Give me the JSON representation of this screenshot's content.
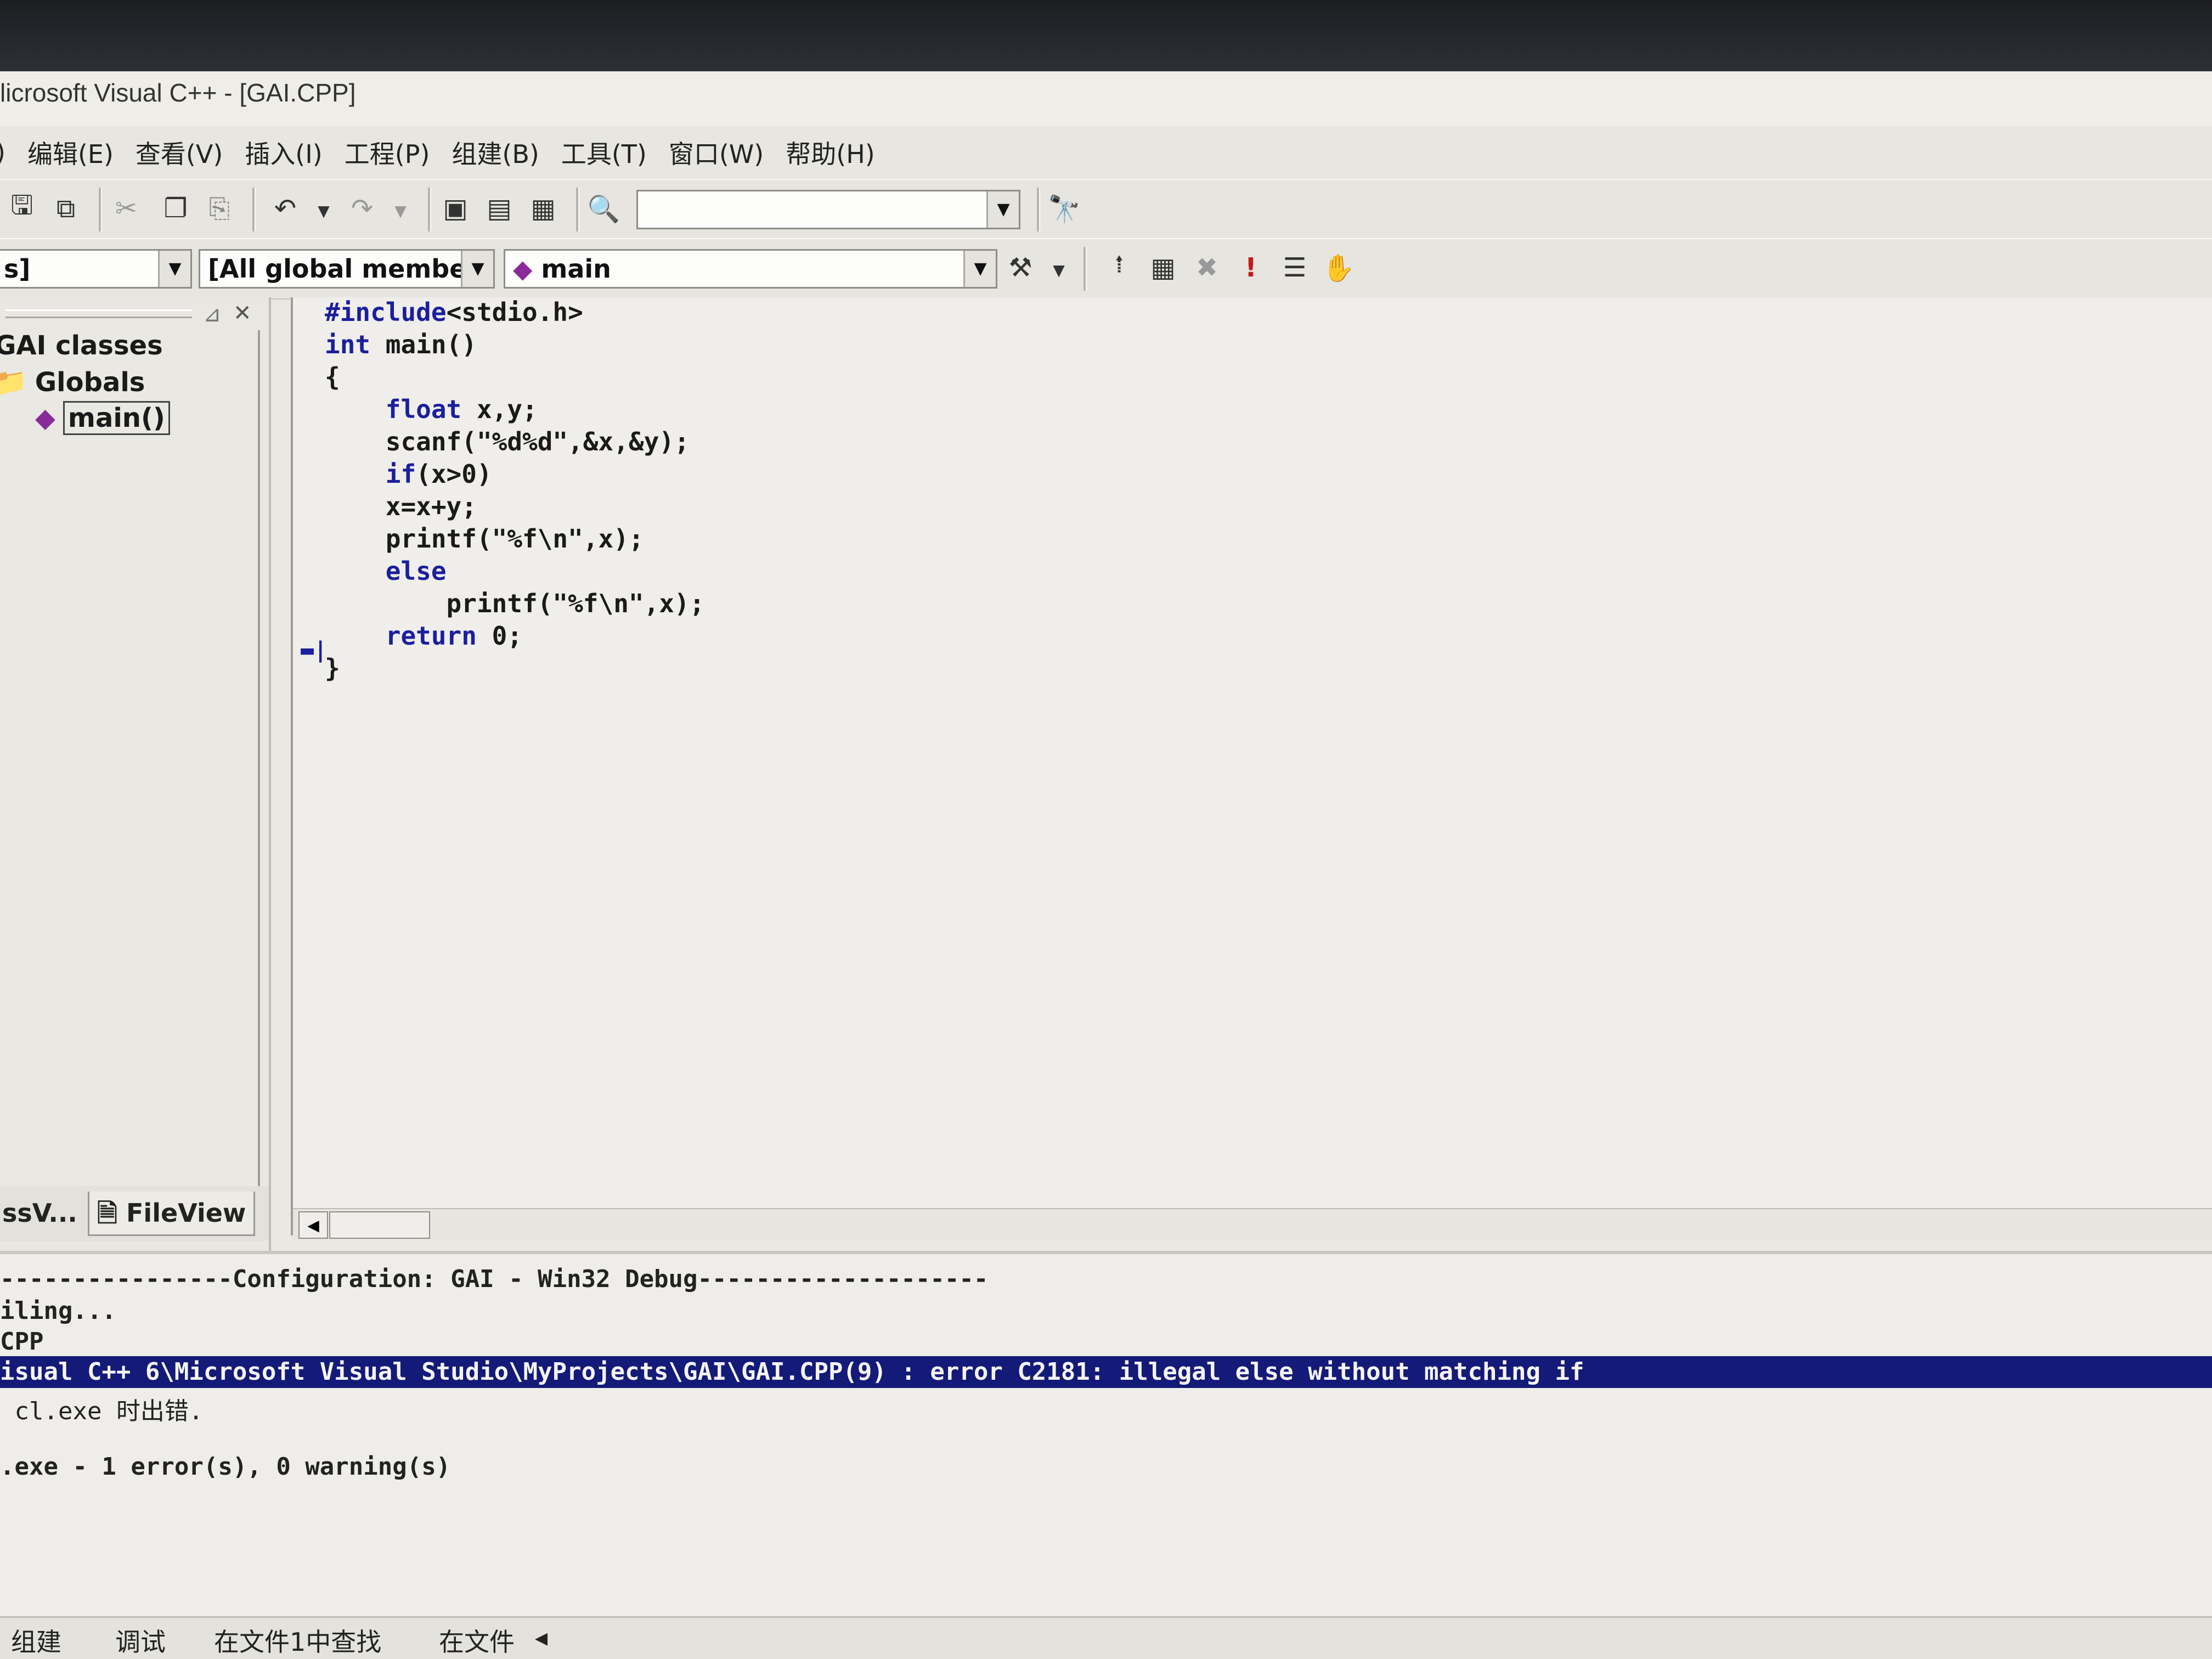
{
  "window": {
    "title": "licrosoft Visual C++ - [GAI.CPP]"
  },
  "menu": [
    {
      "label": ")"
    },
    {
      "label": "编辑(E)"
    },
    {
      "label": "查看(V)"
    },
    {
      "label": "插入(I)"
    },
    {
      "label": "工程(P)"
    },
    {
      "label": "组建(B)"
    },
    {
      "label": "工具(T)"
    },
    {
      "label": "窗口(W)"
    },
    {
      "label": "帮助(H)"
    }
  ],
  "toolbar": {
    "find_combo_value": "",
    "class_combo_value": "s]",
    "filter_combo_value": "[All global members",
    "function_combo_value": "main"
  },
  "workspace": {
    "tree": {
      "root": "GAI classes",
      "group": "Globals",
      "item": "main()"
    },
    "tabs": {
      "class_view": "ssV...",
      "file_view": "FileView"
    }
  },
  "editor": {
    "lines": [
      "#include<stdio.h>",
      "int main()",
      "{",
      "    float x,y;",
      "    scanf(\"%d%d\",&x,&y);",
      "    if(x>0)",
      "    x=x+y;",
      "    printf(\"%f\\n\",x);",
      "    else",
      "        printf(\"%f\\n\",x);",
      "    return 0;",
      "}"
    ]
  },
  "output": {
    "lines": [
      "----------------Configuration: GAI - Win32 Debug--------------------",
      "iling...",
      "CPP",
      "isual C++ 6\\Microsoft Visual Studio\\MyProjects\\GAI\\GAI.CPP(9) : error C2181: illegal else without matching if",
      " cl.exe 时出错.",
      "",
      ".exe - 1 error(s), 0 warning(s)"
    ],
    "tabs": [
      "组建",
      "调试",
      "在文件1中查找",
      "在文件"
    ]
  },
  "colors": {
    "keyword": "#1b1f9c",
    "error_highlight": "#141a78",
    "breakpoint_marker": "#1b1f9c"
  }
}
